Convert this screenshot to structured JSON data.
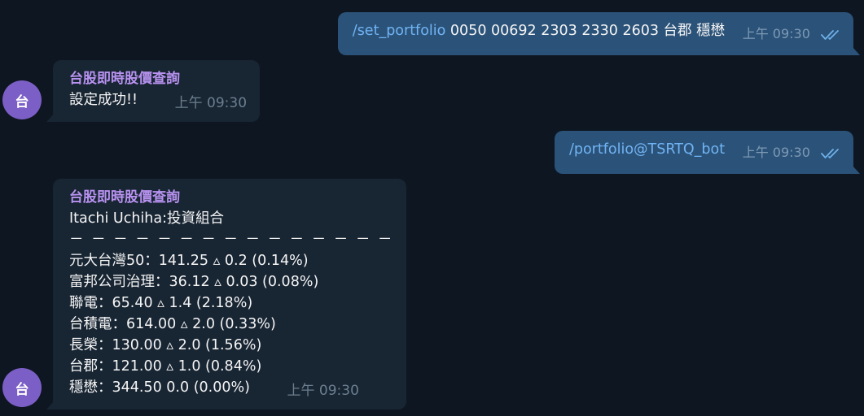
{
  "messages": {
    "out1": {
      "command": "/set_portfolio",
      "args": " 0050 00692 2303 2330 2603 台郡 穩懋",
      "time": "上午 09:30"
    },
    "in1": {
      "sender": "台股即時股價查詢",
      "text": "設定成功!!",
      "time": "上午 09:30"
    },
    "out2": {
      "command": "/portfolio@TSRTQ_bot",
      "time": "上午 09:30"
    },
    "in2": {
      "sender": "台股即時股價查詢",
      "title": "Itachi Uchiha:投資組合",
      "separator": "－ － － － － － － － － － － － － － －",
      "lines": [
        "元大台灣50：141.25 ▵  0.2 (0.14%)",
        "富邦公司治理：36.12 ▵  0.03 (0.08%)",
        "聯電：65.40 ▵  1.4 (2.18%)",
        "台積電：614.00 ▵  2.0 (0.33%)",
        "長榮：130.00 ▵  2.0 (1.56%)",
        "台郡：121.00 ▵  1.0 (0.84%)",
        "穩懋：344.50  0.0 (0.00%)"
      ],
      "time": "上午 09:30"
    }
  },
  "avatar": {
    "label": "台",
    "color": "#7b5fc6"
  },
  "colors": {
    "background": "#0e1621",
    "outgoing": "#2b5278",
    "incoming": "#182533",
    "sender_name": "#b892f0",
    "command_link": "#71b4f5"
  },
  "icons": {
    "read_receipt": "double-check-icon"
  }
}
